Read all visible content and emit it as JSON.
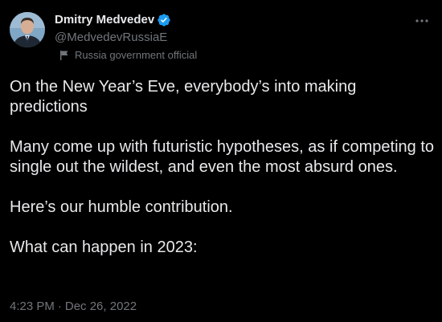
{
  "author": {
    "display_name": "Dmitry Medvedev",
    "handle": "@MedvedevRussiaE",
    "affiliation": "Russia government official",
    "verified_color": "#1d9bf0"
  },
  "tweet": {
    "paragraphs": [
      "On the New Year’s Eve, everybody’s into making predictions",
      "Many come up with futuristic hypotheses, as if competing to single out the wildest, and even the most absurd ones.",
      "Here’s our humble contribution.",
      "What can happen in 2023:"
    ],
    "time": "4:23 PM",
    "separator": "·",
    "date": "Dec 26, 2022"
  },
  "icons": {
    "verified": "verified-badge-icon",
    "affiliation": "flag-icon",
    "more": "more-options-icon"
  },
  "colors": {
    "background": "#000000",
    "text_primary": "#e7e9ea",
    "text_secondary": "#71767b"
  }
}
